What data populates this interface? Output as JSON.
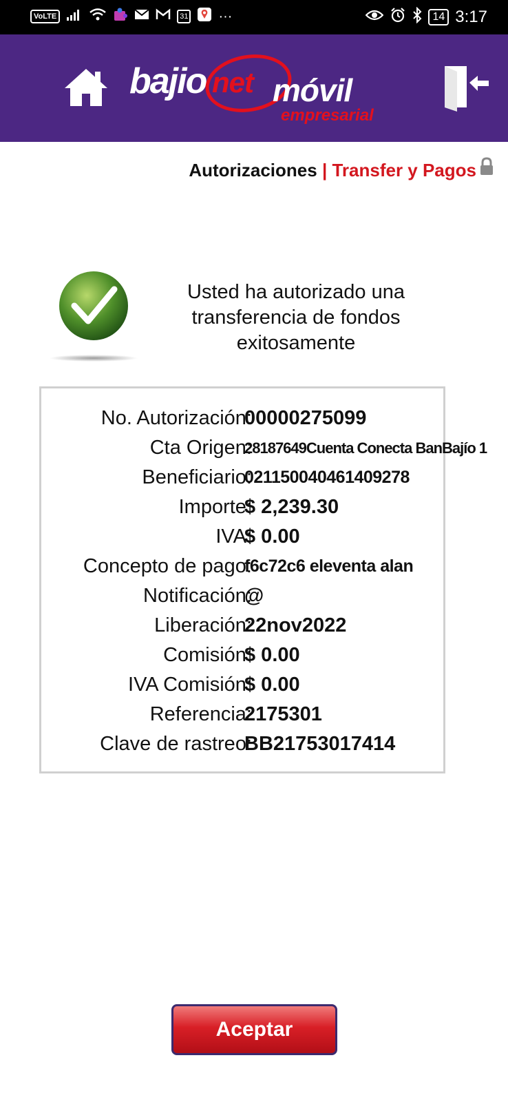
{
  "status_bar": {
    "network_badge": "VoLTE",
    "calendar_badge": "31",
    "more": "···",
    "battery": "14",
    "time": "3:17"
  },
  "header": {
    "logo": {
      "part1": "bajio",
      "part2": "net",
      "part3": "móvil",
      "tagline": "empresarial"
    },
    "colors": {
      "background": "#4c2783",
      "brand_red": "#e3101d"
    }
  },
  "breadcrumb": {
    "section": "Autorizaciones",
    "separator": "|",
    "current": "Transfer y Pagos"
  },
  "success": {
    "message": "Usted ha autorizado una transferencia de fondos exitosamente"
  },
  "details": [
    {
      "label": "No. Autorización:",
      "value": "00000275099"
    },
    {
      "label": "Cta Origen:",
      "value": "28187649Cuenta Conecta BanBajío 1"
    },
    {
      "label": "Beneficiario:",
      "value": "021150040461409278"
    },
    {
      "label": "Importe:",
      "value": "$ 2,239.30"
    },
    {
      "label": "IVA:",
      "value": "$ 0.00"
    },
    {
      "label": "Concepto de pago:",
      "value": "f6c72c6 eleventa alan"
    },
    {
      "label": "Notificación:",
      "value": "@"
    },
    {
      "label": "Liberación:",
      "value": "22nov2022"
    },
    {
      "label": "Comisión:",
      "value": "$ 0.00"
    },
    {
      "label": "IVA Comisión:",
      "value": "$ 0.00"
    },
    {
      "label": "Referencia:",
      "value": "2175301"
    },
    {
      "label": "Clave de rastreo:",
      "value": "BB21753017414"
    }
  ],
  "accept_button": {
    "label": "Aceptar"
  }
}
